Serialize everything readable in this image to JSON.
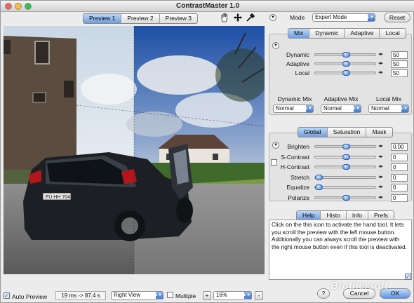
{
  "window": {
    "title": "ContrastMaster 1.0"
  },
  "preview_tabs": [
    "Preview 1",
    "Preview 2",
    "Preview 3"
  ],
  "tools": {
    "hand": "hand-icon",
    "move": "move-icon",
    "picker": "eyedropper-icon"
  },
  "mode": {
    "label": "Mode",
    "value": "Expert Mode",
    "reset": "Reset"
  },
  "mix_tabs": [
    "Mix",
    "Dynamic",
    "Adaptive",
    "Local"
  ],
  "mix_sliders": [
    {
      "label": "Dynamic",
      "value": "50",
      "level": 0.5
    },
    {
      "label": "Adaptive",
      "value": "50",
      "level": 0.5
    },
    {
      "label": "Local",
      "value": "50",
      "level": 0.5
    }
  ],
  "mix_modes": [
    {
      "label": "Dynamic Mix",
      "value": "Normal"
    },
    {
      "label": "Adaptive Mix",
      "value": "Normal"
    },
    {
      "label": "Local Mix",
      "value": "Normal"
    }
  ],
  "global_tabs": [
    "Global",
    "Saturation",
    "Mask"
  ],
  "global_sliders": [
    {
      "label": "Brighten",
      "value": "0.00",
      "level": 0.5
    },
    {
      "label": "S-Contrast",
      "value": "0",
      "level": 0.5
    },
    {
      "label": "H-Contrast",
      "value": "0",
      "level": 0.5
    },
    {
      "label": "Stretch",
      "value": "0",
      "level": 0.0
    },
    {
      "label": "Equalize",
      "value": "0",
      "level": 0.0
    },
    {
      "label": "Polarize",
      "value": "0",
      "level": 0.5
    }
  ],
  "help_tabs": [
    "Help",
    "Histo",
    "Info",
    "Prefs"
  ],
  "help_text": "Click on the this icon to activate the hand tool. It lets you scroll the preview with the left mouse button. Additionally you can always scroll the preview with the right mouse button even if this tool is deactivated.",
  "bottom": {
    "auto_preview": "Auto Preview",
    "timing": "19 ms -> 87.4 s",
    "view": "Right View",
    "multiple": "Multiple",
    "zoom": "16%",
    "plus": "+",
    "minus": "-",
    "help": "?",
    "cancel": "Cancel",
    "ok": "OK"
  },
  "watermark": "Brothersoft",
  "colors": {
    "accent": "#4a86de",
    "selected_tab": "#7aa8e6"
  }
}
